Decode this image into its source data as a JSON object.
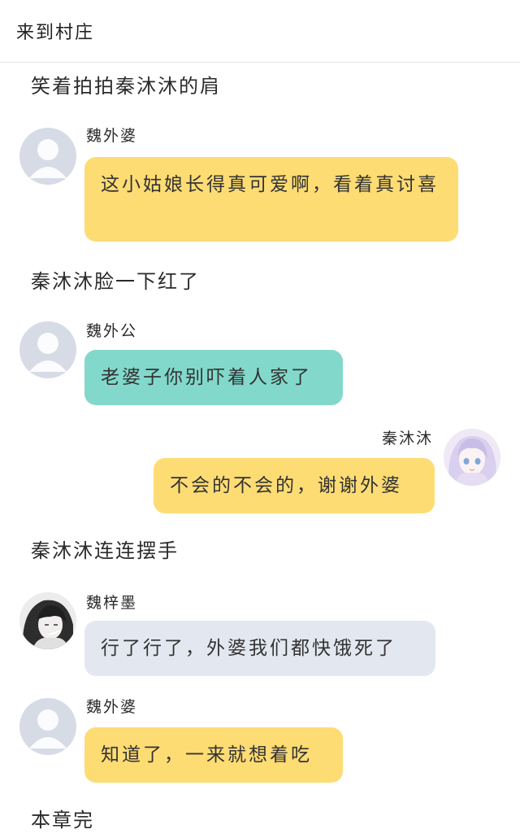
{
  "header": {
    "title": "来到村庄"
  },
  "narrations": [
    "笑着拍拍秦沐沐的肩",
    "秦沐沐脸一下红了",
    "秦沐沐连连摆手",
    "本章完"
  ],
  "messages": [
    {
      "speaker": "魏外婆",
      "text": "这小姑娘长得真可爱啊，看着真讨喜",
      "avatar_icon": "default-avatar-icon",
      "bubble_color": "#fedc74"
    },
    {
      "speaker": "魏外公",
      "text": "老婆子你别吓着人家了",
      "avatar_icon": "default-avatar-icon",
      "bubble_color": "#82d9cb"
    },
    {
      "speaker": "秦沐沐",
      "text": "不会的不会的，谢谢外婆",
      "avatar_icon": "anime-girl-avatar",
      "bubble_color": "#fedc74"
    },
    {
      "speaker": "魏梓墨",
      "text": "行了行了，外婆我们都快饿死了",
      "avatar_icon": "anime-boy-avatar",
      "bubble_color": "#e3e8f0"
    },
    {
      "speaker": "魏外婆",
      "text": "知道了，一来就想着吃",
      "avatar_icon": "default-avatar-icon",
      "bubble_color": "#fedc74"
    }
  ]
}
